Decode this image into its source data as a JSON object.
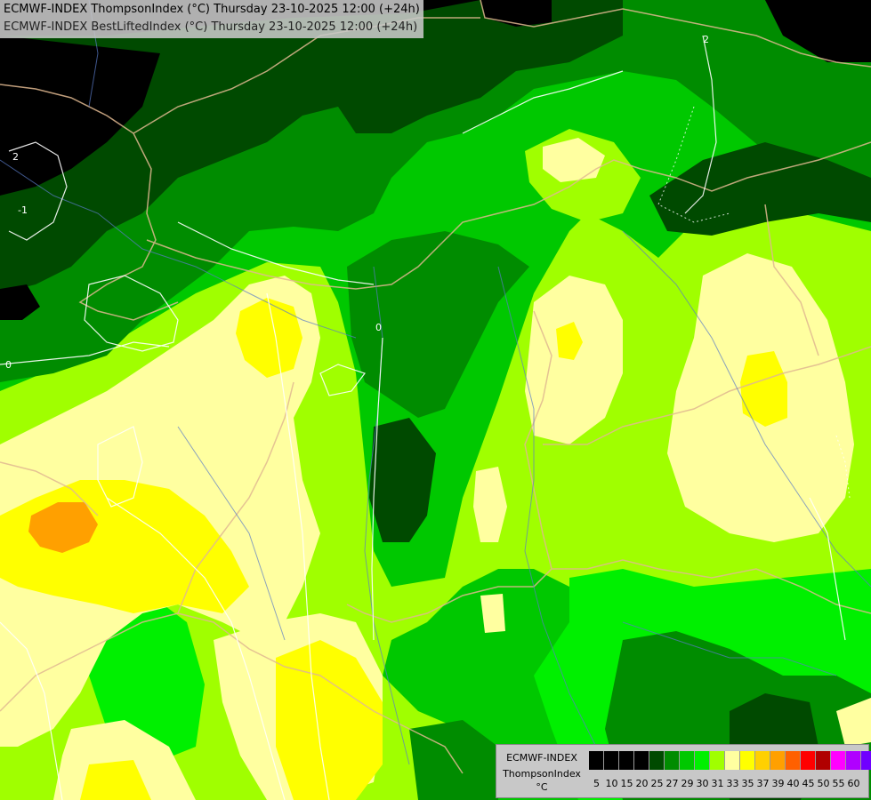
{
  "header": {
    "line1": "ECMWF-INDEX ThompsonIndex (°C) Thursday 23-10-2025 12:00 (+24h)",
    "line2": "ECMWF-INDEX BestLiftedIndex (°C) Thursday 23-10-2025 12:00 (+24h)"
  },
  "legend": {
    "model": "ECMWF-INDEX",
    "parameter": "ThompsonIndex",
    "unit": "°C",
    "ticks": [
      "5",
      "10",
      "15",
      "20",
      "25",
      "27",
      "29",
      "30",
      "31",
      "33",
      "35",
      "37",
      "39",
      "40",
      "45",
      "50",
      "55",
      "60"
    ],
    "colors": [
      "#000000",
      "#000000",
      "#000000",
      "#000000",
      "#004a00",
      "#008c00",
      "#00c800",
      "#00f000",
      "#a0ff00",
      "#ffffa0",
      "#ffff00",
      "#ffd000",
      "#ffa000",
      "#ff6000",
      "#ff0000",
      "#b00000",
      "#ff00ff",
      "#b000ff",
      "#7000ff",
      "#0000ff"
    ]
  },
  "map": {
    "field_colors": {
      "black": "#000000",
      "dark_green": "#004a00",
      "green": "#008c00",
      "mid_green": "#00c800",
      "bright_green": "#00f000",
      "lime": "#a0ff00",
      "pale_yellow": "#ffffa0",
      "yellow": "#ffff00",
      "orange": "#ffa000"
    },
    "contour_line_labels": [
      "0",
      "-1",
      "2",
      "2",
      "0"
    ]
  }
}
